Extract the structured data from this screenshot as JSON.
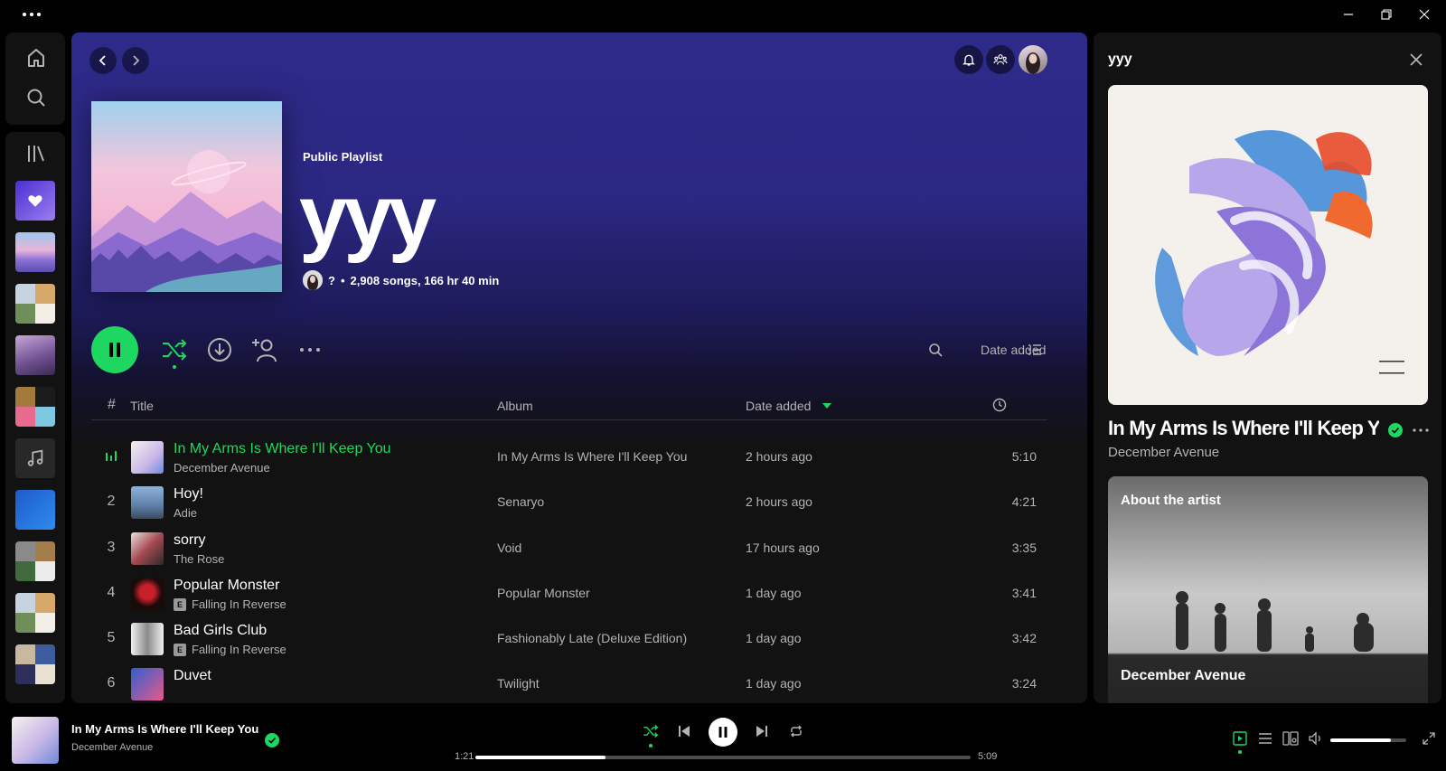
{
  "colors": {
    "accent": "#1ed760",
    "header_gradient": "#2e2a8a",
    "bg": "#121212"
  },
  "playlist": {
    "type_label": "Public Playlist",
    "title": "yyy",
    "owner": "?",
    "stats": "2,908 songs, 166 hr 40 min"
  },
  "toolbar": {
    "sort_label": "Date added"
  },
  "table": {
    "headers": {
      "num": "#",
      "title": "Title",
      "album": "Album",
      "date": "Date added"
    },
    "rows": [
      {
        "num": "",
        "title": "In My Arms Is Where I'll Keep You",
        "artist": "December Avenue",
        "explicit": false,
        "album": "In My Arms Is Where I'll Keep You",
        "date": "2 hours ago",
        "duration": "5:10",
        "playing": true
      },
      {
        "num": "2",
        "title": "Hoy!",
        "artist": "Adie",
        "explicit": false,
        "album": "Senaryo",
        "date": "2 hours ago",
        "duration": "4:21"
      },
      {
        "num": "3",
        "title": "sorry",
        "artist": "The Rose",
        "explicit": false,
        "album": "Void",
        "date": "17 hours ago",
        "duration": "3:35"
      },
      {
        "num": "4",
        "title": "Popular Monster",
        "artist": "Falling In Reverse",
        "explicit": true,
        "album": "Popular Monster",
        "date": "1 day ago",
        "duration": "3:41"
      },
      {
        "num": "5",
        "title": "Bad Girls Club",
        "artist": "Falling In Reverse",
        "explicit": true,
        "album": "Fashionably Late (Deluxe Edition)",
        "date": "1 day ago",
        "duration": "3:42"
      },
      {
        "num": "6",
        "title": "Duvet",
        "artist": "",
        "explicit": false,
        "album": "Twilight",
        "date": "1 day ago",
        "duration": "3:24"
      }
    ],
    "explicit_label": "E"
  },
  "right_panel": {
    "title": "yyy",
    "song": "In My Arms Is Where I'll Keep You",
    "artist": "December Avenue",
    "about_label": "About the artist",
    "about_name": "December Avenue"
  },
  "player": {
    "song": "In My Arms Is Where I'll Keep You",
    "artist": "December Avenue",
    "elapsed": "1:21",
    "total": "5:09",
    "progress": 0.262,
    "volume": 0.8
  }
}
